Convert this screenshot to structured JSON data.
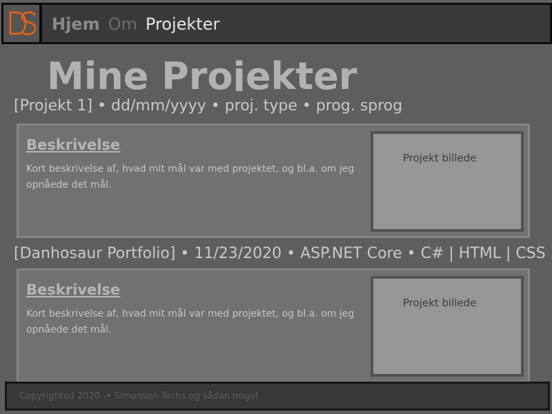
{
  "brand": {
    "logo_text": "DS",
    "logo_color": "#e8620f"
  },
  "nav": {
    "items": [
      "Hjem",
      "Om",
      "Projekter"
    ]
  },
  "page_title": "Mine Projekter",
  "projects": [
    {
      "meta": "[Projekt 1] • dd/mm/yyyy • proj. type • prog. sprog",
      "heading": "Beskrivelse",
      "description": "Kort beskrivelse af, hvad mit mål var med projektet, og bl.a. om jeg opnåede det mål.",
      "image_label": "Projekt billede"
    },
    {
      "meta": "[Danhosaur Portfolio] • 11/23/2020 • ASP.NET Core • C# | HTML | CSS",
      "heading": "Beskrivelse",
      "description": "Kort beskrivelse af, hvad mit mål var med projektet, og bl.a. om jeg opnåede det mål.",
      "image_label": "Projekt billede"
    }
  ],
  "footer": {
    "text": "Copyrighted 2020 -• Simonsen Techs og sådan noget"
  }
}
